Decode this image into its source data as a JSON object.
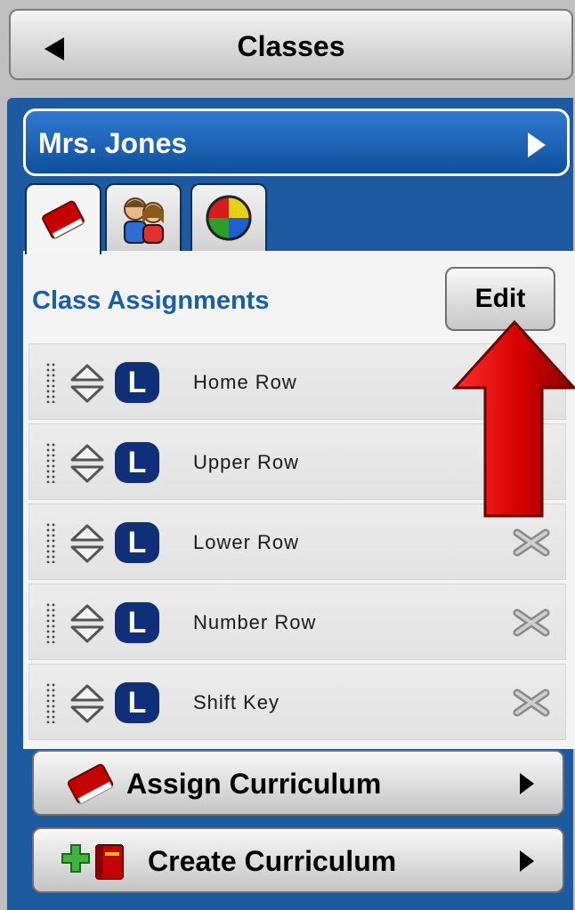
{
  "header": {
    "back_label": "Classes"
  },
  "teacher": {
    "name": "Mrs. Jones"
  },
  "tabs": [
    {
      "icon": "curriculum-book-icon",
      "active": true
    },
    {
      "icon": "students-icon",
      "active": false
    },
    {
      "icon": "reports-pie-icon",
      "active": false
    }
  ],
  "assignments": {
    "title": "Class Assignments",
    "edit_label": "Edit",
    "items": [
      {
        "label": "Home Row",
        "badge": "L"
      },
      {
        "label": "Upper Row",
        "badge": "L"
      },
      {
        "label": "Lower Row",
        "badge": "L"
      },
      {
        "label": "Number Row",
        "badge": "L"
      },
      {
        "label": "Shift Key",
        "badge": "L"
      }
    ]
  },
  "actions": {
    "assign_label": "Assign Curriculum",
    "create_label": "Create Curriculum"
  },
  "colors": {
    "panel_blue": "#1e5aa0",
    "title_blue": "#1a5ea8",
    "badge_navy": "#0f2f78",
    "arrow_red": "#d40000"
  }
}
